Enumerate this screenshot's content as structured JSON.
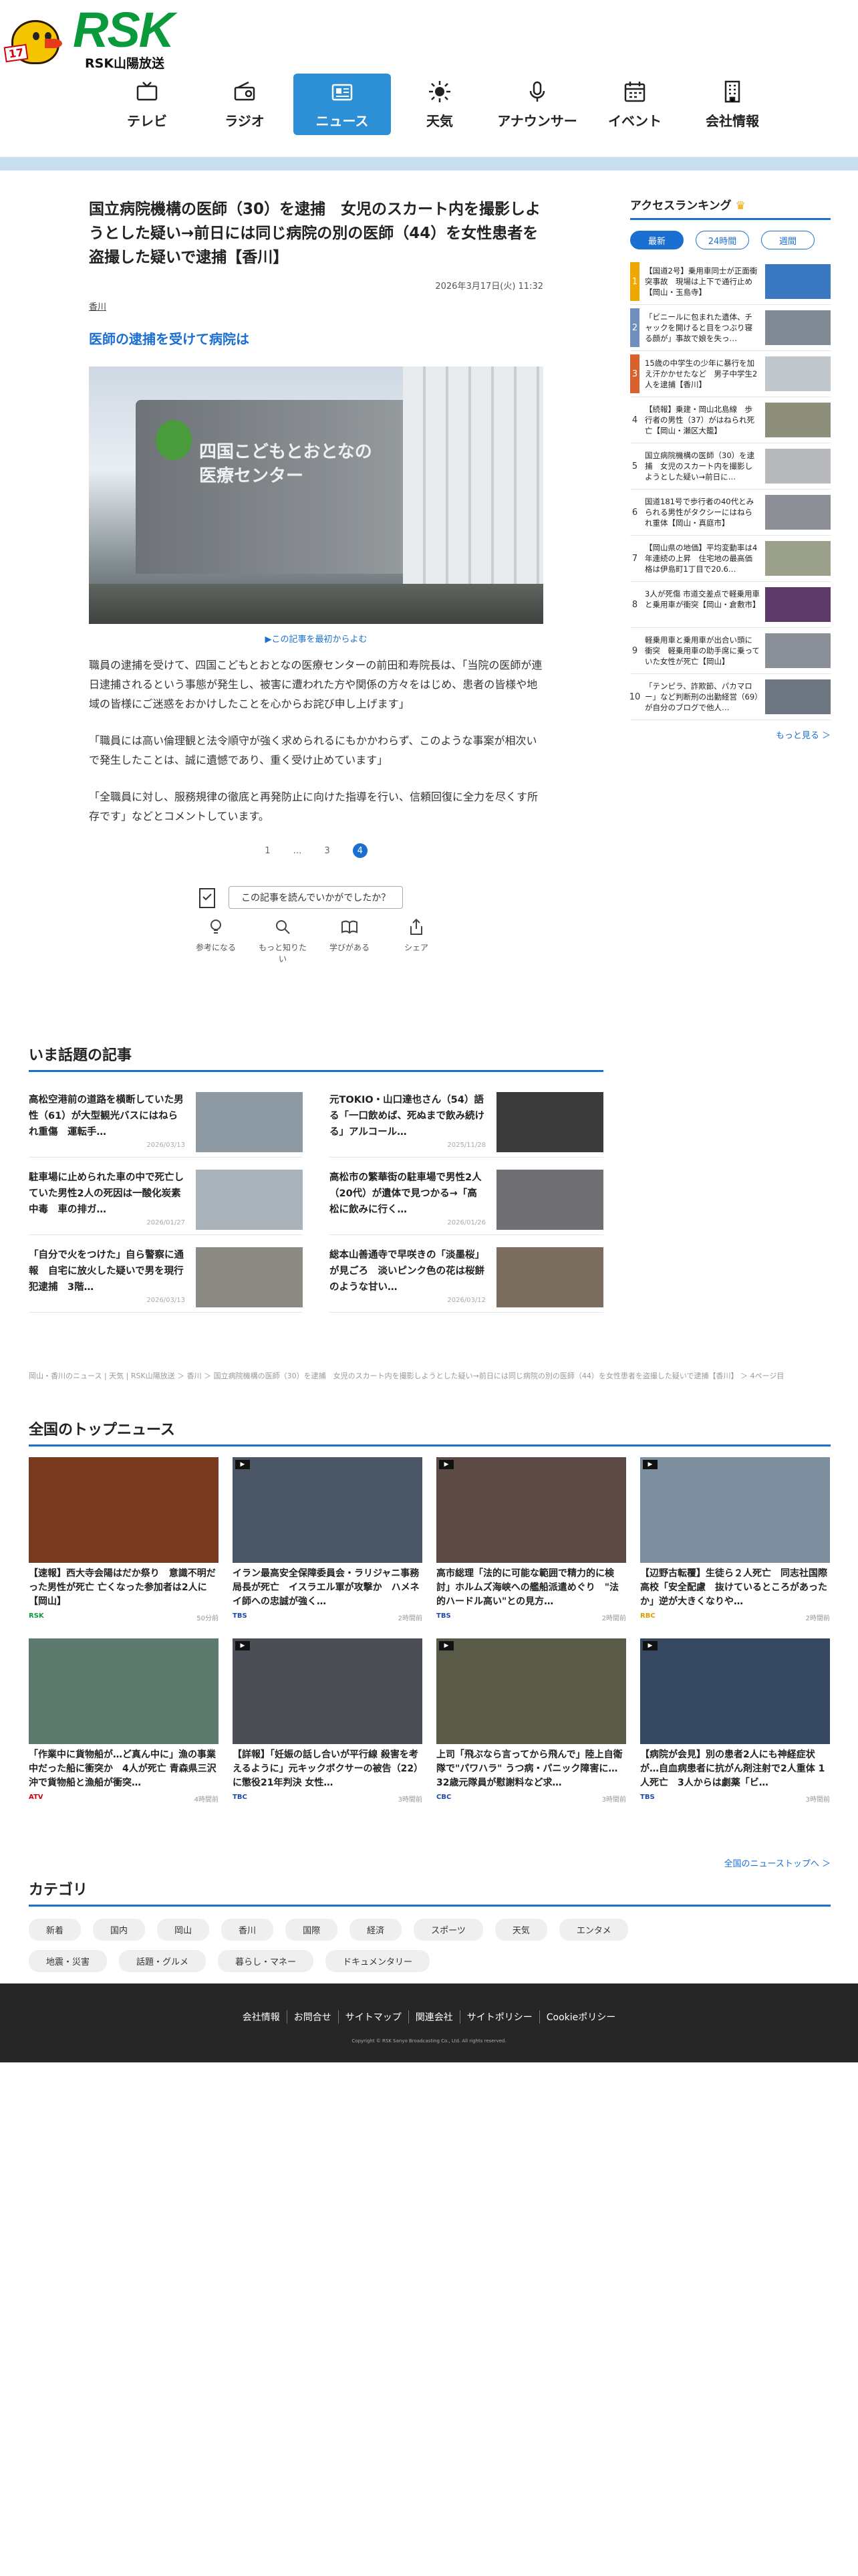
{
  "brand": {
    "name": "RSK",
    "sub": "RSK山陽放送",
    "mascot_tag": "17"
  },
  "nav": [
    {
      "label": "テレビ",
      "icon": "tv-icon"
    },
    {
      "label": "ラジオ",
      "icon": "radio-icon"
    },
    {
      "label": "ニュース",
      "icon": "news-icon",
      "active": true
    },
    {
      "label": "天気",
      "icon": "sun-icon"
    },
    {
      "label": "アナウンサー",
      "icon": "microphone-icon"
    },
    {
      "label": "イベント",
      "icon": "calendar-icon"
    },
    {
      "label": "会社情報",
      "icon": "building-icon"
    }
  ],
  "article": {
    "headline": "国立病院機構の医師（30）を逮捕　女児のスカート内を撮影しようとした疑い→前日には同じ病院の別の医師（44）を女性患者を盗撮した疑いで逮捕【香川】",
    "date": "2026年3月17日(火) 11:32",
    "category": "香川",
    "subhead": "医師の逮捕を受けて病院は",
    "photo_text": "四国こどもとおとなの医療センター",
    "first_link": "▶この記事を最初からよむ",
    "paragraphs": [
      "職員の逮捕を受けて、四国こどもとおとなの医療センターの前田和寿院長は、「当院の医師が連日逮捕されるという事態が発生し、被害に遭われた方や関係の方々をはじめ、患者の皆様や地域の皆様にご迷惑をおかけしたことを心からお詫び申し上げます」",
      "「職員には高い倫理観と法令順守が強く求められるにもかかわらず、このような事案が相次いで発生したことは、誠に遺憾であり、重く受け止めています」",
      "「全職員に対し、服務規律の徹底と再発防止に向けた指導を行い、信頼回復に全力を尽くす所存です」などとコメントしています。"
    ],
    "pager": [
      "1",
      "…",
      "3",
      "4"
    ],
    "feedback_q": "この記事を読んでいかがでしたか？",
    "reactions": [
      {
        "label": "参考になる",
        "icon": "lightbulb-icon"
      },
      {
        "label": "もっと知りたい",
        "icon": "search-icon"
      },
      {
        "label": "学びがある",
        "icon": "book-icon"
      },
      {
        "label": "シェア",
        "icon": "share-icon"
      }
    ]
  },
  "ranking": {
    "title": "アクセスランキング",
    "tabs": [
      "最新",
      "24時間",
      "週間"
    ],
    "items": [
      {
        "n": "1",
        "color": "#f0a800",
        "text": "【国道2号】乗用車同士が正面衝突事故　現場は上下で通行止め【岡山・玉島寺】"
      },
      {
        "n": "2",
        "color": "#6f8fbf",
        "text": "「ビニールに包まれた遺体、チャックを開けると目をつぶり寝る顔が」事故で娘を失っ…"
      },
      {
        "n": "3",
        "color": "#d9612b",
        "text": "15歳の中学生の少年に暴行を加え汗かかせたなど　男子中学生2人を逮捕【香川】"
      },
      {
        "n": "4",
        "color": "",
        "text": "【続報】乗建・岡山北島線　歩行者の男性（37）がはねられ死亡【岡山・瀬区大籠】"
      },
      {
        "n": "5",
        "color": "",
        "text": "国立病院機構の医師（30）を逮捕　女児のスカート内を撮影しようとした疑い→前日に…"
      },
      {
        "n": "6",
        "color": "",
        "text": "国道181号で歩行者の40代とみられる男性がタクシーにはねられ重体【岡山・真庭市】"
      },
      {
        "n": "7",
        "color": "",
        "text": "【岡山県の地価】平均変動率は4年連続の上昇　住宅地の最高価格は伊島町1丁目で20.6…"
      },
      {
        "n": "8",
        "color": "",
        "text": "3人が死傷 市道交差点で軽乗用車と乗用車が衝突【岡山・倉敷市】"
      },
      {
        "n": "9",
        "color": "",
        "text": "軽乗用車と乗用車が出合い頭に衝突　軽乗用車の助手席に乗っていた女性が死亡【岡山】"
      },
      {
        "n": "10",
        "color": "",
        "text": "「テンピラ、詐欺節、パカマロー」など判断刑の出勤経営（69）が自分のブログで他人…"
      }
    ],
    "more": "もっと見る ＞"
  },
  "topics": {
    "title": "いま話題の記事",
    "items": [
      {
        "title": "高松空港前の道路を横断していた男性（61）が大型観光バスにはねられ重傷　運転手…",
        "date": "2026/03/13"
      },
      {
        "title": "元TOKIO・山口達也さん（54）語る「一口飲めば、死ぬまで飲み続ける」アルコール…",
        "date": "2025/11/28"
      },
      {
        "title": "駐車場に止められた車の中で死亡していた男性2人の死因は一酸化炭素中毒　車の排ガ…",
        "date": "2026/01/27"
      },
      {
        "title": "高松市の繁華街の駐車場で男性2人（20代）が遺体で見つかる→「高松に飲みに行く…",
        "date": "2026/01/26"
      },
      {
        "title": "「自分で火をつけた」自ら警察に通報　自宅に放火した疑いで男を現行犯逮捕　3階…",
        "date": "2026/03/13"
      },
      {
        "title": "総本山善通寺で早咲きの「淡墨桜」が見ごろ　淡いピンク色の花は桜餅のような甘い…",
        "date": "2026/03/12"
      }
    ]
  },
  "breadcrumb": "岡山・香川のニュース | 天気 | RSK山陽放送 ＞ 香川 ＞ 国立病院機構の医師（30）を逮捕　女児のスカート内を撮影しようとした疑い→前日には同じ病院の別の医師（44）を女性患者を盗撮した疑いで逮捕【香川】 ＞ 4ページ目",
  "national": {
    "title": "全国のトップニュース",
    "items": [
      {
        "title": "【速報】西大寺会陽はだか祭り　意識不明だった男性が死亡 亡くなった参加者は2人に【岡山】",
        "src": "RSK",
        "src_color": "#0a9a3c",
        "ago": "50分前",
        "play": false,
        "bg": "#7a3a20"
      },
      {
        "title": "イラン最高安全保障委員会・ラリジャニ事務局長が死亡　イスラエル軍が攻撃か　ハメネイ師への忠誠が強く…",
        "src": "TBS",
        "src_color": "#1b4aa8",
        "ago": "2時間前",
        "play": true,
        "bg": "#4a5666"
      },
      {
        "title": "高市総理「法的に可能な範囲で精力的に検討」ホルムズ海峡への艦船派遣めぐり　\"法的ハードル高い\"との見方…",
        "src": "TBS",
        "src_color": "#1b4aa8",
        "ago": "2時間前",
        "play": true,
        "bg": "#5b4b44"
      },
      {
        "title": "【辺野古転覆】生徒ら２人死亡　同志社国際高校「安全配慮　抜けているところがあったか」逆が大きくなりや…",
        "src": "RBC",
        "src_color": "#d5a000",
        "ago": "2時間前",
        "play": true,
        "bg": "#7d8f9e"
      },
      {
        "title": "「作業中に貨物船が…ど真ん中に」漁の事業中だった船に衝突か　4人が死亡 青森県三沢沖で貨物船と漁船が衝突…",
        "src": "ATV",
        "src_color": "#d0000f",
        "ago": "4時間前",
        "play": false,
        "bg": "#5d7a6e"
      },
      {
        "title": "【詳報】「妊娠の話し合いが平行線 殺害を考えるように」元キックボクサーの被告（22）に懲役21年判決 女性…",
        "src": "TBC",
        "src_color": "#1b4aa8",
        "ago": "3時間前",
        "play": true,
        "bg": "#4b4f55"
      },
      {
        "title": "上司「飛ぶなら言ってから飛んで」陸上自衛隊で\"パワハラ\" うつ病・パニック障害に…32歳元隊員が慰謝料など求…",
        "src": "CBC",
        "src_color": "#1b4aa8",
        "ago": "3時間前",
        "play": true,
        "bg": "#5a5a48"
      },
      {
        "title": "【病院が会見】別の患者2人にも神経症状が…自血病患者に抗がん剤注射で2人重体 1人死亡　3人からは劇薬「ビ…",
        "src": "TBS",
        "src_color": "#1b4aa8",
        "ago": "3時間前",
        "play": true,
        "bg": "#35485f"
      }
    ],
    "more": "全国のニューストップへ ＞"
  },
  "categories": {
    "title": "カテゴリ",
    "items": [
      "新着",
      "国内",
      "岡山",
      "香川",
      "国際",
      "経済",
      "スポーツ",
      "天気",
      "エンタメ",
      "地震・災害",
      "話題・グルメ",
      "暮らし・マネー",
      "ドキュメンタリー"
    ]
  },
  "footer": {
    "links": [
      "会社情報",
      "お問合せ",
      "サイトマップ",
      "関連会社",
      "サイトポリシー",
      "Cookieポリシー"
    ],
    "copyright": "Copyright © RSK Sanyo Broadcasting Co., Ltd. All rights reserved."
  }
}
